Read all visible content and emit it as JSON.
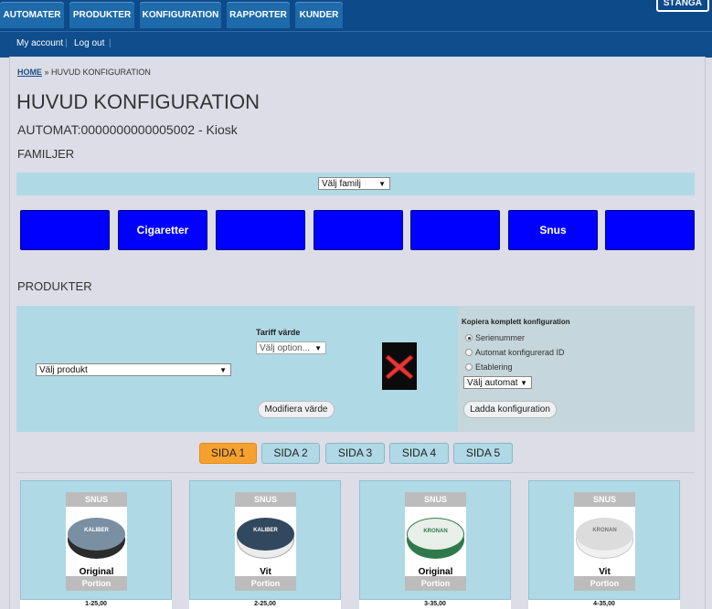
{
  "nav": {
    "tabs": [
      {
        "label": "AUTOMATER"
      },
      {
        "label": "PRODUKTER"
      },
      {
        "label": "KONFIGURATION"
      },
      {
        "label": "RAPPORTER"
      },
      {
        "label": "KUNDER"
      }
    ],
    "close_label": "STÄNGA"
  },
  "subnav": {
    "my_account": "My account",
    "separator": "|",
    "logout": "Log out"
  },
  "breadcrumb": {
    "home": "HOME",
    "separator": "»",
    "current": "HUVUD KONFIGURATION"
  },
  "page": {
    "title": "HUVUD KONFIGURATION",
    "automat": "AUTOMAT:0000000000005002 - Kiosk"
  },
  "families": {
    "heading": "FAMILJER",
    "select_value": "Välj familj",
    "tiles": [
      {
        "label": ""
      },
      {
        "label": "Cigaretter"
      },
      {
        "label": ""
      },
      {
        "label": ""
      },
      {
        "label": ""
      },
      {
        "label": "Snus"
      },
      {
        "label": ""
      }
    ],
    "tile_color": "#0000ff"
  },
  "products": {
    "heading": "PRODUKTER",
    "product_select": "Välj produkt",
    "tariff_label": "Tariff värde",
    "tariff_select": "Välj option...",
    "modify_button": "Modifiera värde",
    "delete_icon": "red-x-icon"
  },
  "copy_config": {
    "heading": "Kopiera komplett konfiguration",
    "options": [
      {
        "label": "Serienummer",
        "selected": true
      },
      {
        "label": "Automat konfigurerad ID",
        "selected": false
      },
      {
        "label": "Etablering",
        "selected": false
      }
    ],
    "automat_select": "Välj automat",
    "load_button": "Ladda konfiguration"
  },
  "pager": {
    "pages": [
      "SIDA 1",
      "SIDA 2",
      "SIDA 3",
      "SIDA 4",
      "SIDA 5"
    ],
    "active_index": 0,
    "active_color": "#f6a12f"
  },
  "cards": [
    {
      "brand_band": "SNUS",
      "can_text": "KALIBER",
      "name": "Original",
      "variant": "Portion",
      "price": "1-25,00",
      "can_color": "#2b2b2b",
      "lid_color": "#7b8fa3"
    },
    {
      "brand_band": "SNUS",
      "can_text": "KALIBER",
      "name": "Vit",
      "variant": "Portion",
      "price": "2-25,00",
      "can_color": "#ececec",
      "lid_color": "#31485f"
    },
    {
      "brand_band": "SNUS",
      "can_text": "KRONAN",
      "name": "Original",
      "variant": "Portion",
      "price": "3-35,00",
      "can_color": "#2f7a4a",
      "lid_color": "#e9efe9"
    },
    {
      "brand_band": "SNUS",
      "can_text": "KRONAN",
      "name": "Vit",
      "variant": "Portion",
      "price": "4-35,00",
      "can_color": "#f0f0f0",
      "lid_color": "#dcdcdc"
    }
  ]
}
